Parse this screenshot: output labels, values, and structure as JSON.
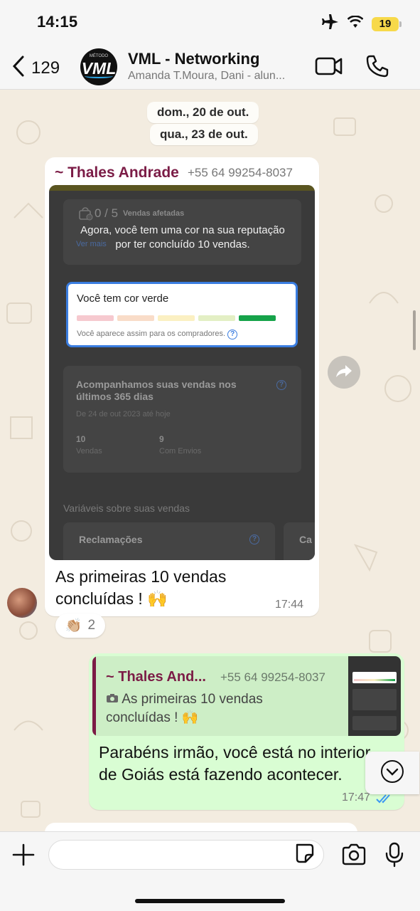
{
  "status_bar": {
    "time": "14:15",
    "battery": "19"
  },
  "header": {
    "back_count": "129",
    "avatar_small": "MÉTODO",
    "avatar_text": "VML",
    "title": "VML - Networking",
    "subtitle": "Amanda T.Moura, Dani - alun..."
  },
  "dates": [
    "dom., 20 de out.",
    "qua., 23 de out."
  ],
  "message_in": {
    "sender": "~ Thales Andrade",
    "phone": "+55 64 99254-8037",
    "image": {
      "count": "0 / 5",
      "count_label": "Vendas afetadas",
      "ver_mais": "Ver mais",
      "overlay": "Agora, você tem uma cor na sua reputação por ter concluído 10 vendas.",
      "card_title": "Você tem cor verde",
      "card_sub": "Você aparece assim para os compradores.",
      "bars": [
        "#f6c9cf",
        "#f9dcc8",
        "#fbf0c2",
        "#e3efc4",
        "#16a34a"
      ],
      "section_title": "Acompanhamos suas vendas nos últimos 365 dias",
      "section_date": "De 24 de out 2023 até hoje",
      "stat1_value": "10",
      "stat1_label": "Vendas",
      "stat2_value": "9",
      "stat2_label": "Com Envios",
      "variables": "Variáveis sobre suas vendas",
      "reclamacoes": "Reclamações",
      "cut_label": "Ca"
    },
    "caption": "As primeiras 10 vendas concluídas ! 🙌",
    "time": "17:44",
    "reaction_emoji": "👏🏼",
    "reaction_count": "2"
  },
  "message_out": {
    "quote_sender": "~ Thales And...",
    "quote_phone": "+55 64 99254-8037",
    "quote_text": "As primeiras 10 vendas concluídas ! 🙌",
    "text": "Parabéns irmão, você está no interior de Goiás está fazendo acontecer.",
    "time": "17:47"
  },
  "colors": {
    "sender": "#7b1c46",
    "outgoing": "#d9fdd3",
    "tick": "#3b97f3"
  },
  "icons": [
    "back-chevron-icon",
    "video-call-icon",
    "phone-icon",
    "forward-icon",
    "scroll-down-icon",
    "plus-icon",
    "sticker-icon",
    "camera-icon",
    "microphone-icon",
    "airplane-icon",
    "wifi-icon"
  ]
}
